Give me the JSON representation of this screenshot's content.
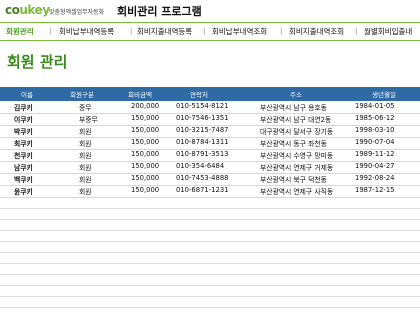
{
  "header": {
    "logo_part1": "co",
    "logo_part2": "ukey",
    "tagline": "맞춤형엑셀업무자동화",
    "app_title": "회비관리 프로그램"
  },
  "tabs": [
    {
      "label": "회원관리",
      "active": true
    },
    {
      "label": "회비납부내역등록",
      "active": false
    },
    {
      "label": "회비지출내역등록",
      "active": false
    },
    {
      "label": "회비납부내역조회",
      "active": false
    },
    {
      "label": "회비지출내역조회",
      "active": false
    },
    {
      "label": "월별회비입출내",
      "active": false
    }
  ],
  "page_title": "회원 관리",
  "table": {
    "columns": [
      "이름",
      "회원구분",
      "회비금액",
      "연락처",
      "주소",
      "생년월일"
    ],
    "rows": [
      [
        "김쿠키",
        "중무",
        "200,000",
        "010-5154-8121",
        "부산광역시 남구 용호동",
        "1984-01-05"
      ],
      [
        "이쿠키",
        "부중무",
        "150,000",
        "010-7546-1351",
        "부산광역시 남구 대연2동",
        "1985-06-12"
      ],
      [
        "박쿠키",
        "회원",
        "150,000",
        "010-3215-7487",
        "대구광역시 달서구 장기동",
        "1998-03-10"
      ],
      [
        "최쿠키",
        "회원",
        "150,000",
        "010-8784-1311",
        "부산광역시 동구 좌천동",
        "1990-07-04"
      ],
      [
        "천쿠키",
        "회원",
        "150,000",
        "010-8791-3513",
        "부산광역시 수영구 망미동",
        "1989-11-12"
      ],
      [
        "남쿠키",
        "회원",
        "150,000",
        "010-354-6484",
        "부산광역시 연제구 거제동",
        "1990-04-27"
      ],
      [
        "백쿠키",
        "회원",
        "150,000",
        "010-7453-4888",
        "부산광역시 북구 덕천동",
        "1992-08-24"
      ],
      [
        "윤쿠키",
        "회원",
        "150,000",
        "010-6871-1231",
        "부산광역시 연제구 사직동",
        "1987-12-15"
      ]
    ]
  },
  "colors": {
    "accent_green": "#4aa31e",
    "header_blue": "#2e6aa3"
  }
}
